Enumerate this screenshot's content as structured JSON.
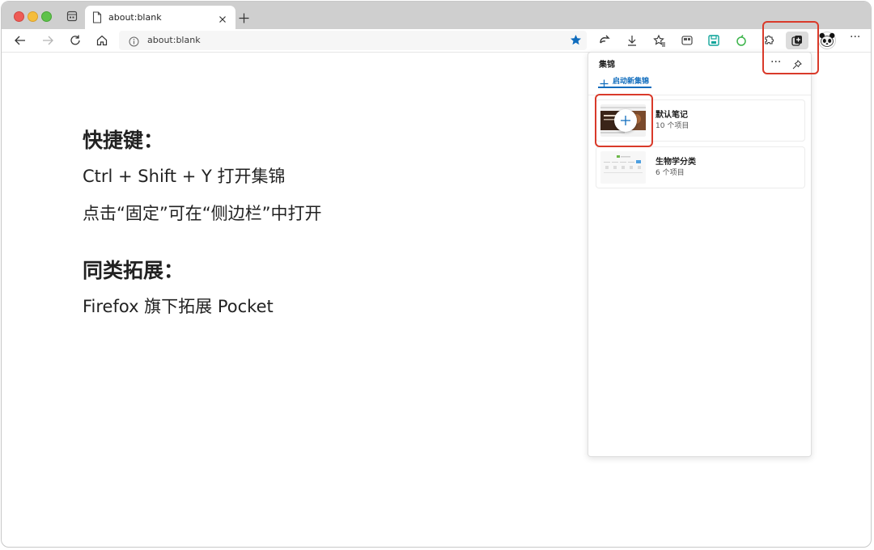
{
  "browser": {
    "tab_title": "about:blank",
    "address": "about:blank"
  },
  "content": {
    "shortcut_heading": "快捷键：",
    "shortcut_line1": "Ctrl + Shift + Y 打开集锦",
    "shortcut_line2": "点击“固定”可在“侧边栏”中打开",
    "similar_heading": "同类拓展：",
    "similar_line1": "Firefox 旗下拓展 Pocket"
  },
  "collections_panel": {
    "title": "集锦",
    "new_collection_label": "启动新集锦",
    "more_label": "···",
    "items": [
      {
        "name": "默认笔记",
        "count": "10 个项目"
      },
      {
        "name": "生物学分类",
        "count": "6 个项目"
      }
    ]
  },
  "colors": {
    "accent": "#0f6cbd",
    "highlight": "#d93a2a"
  }
}
